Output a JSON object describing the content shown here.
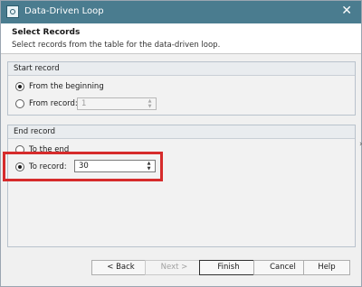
{
  "window": {
    "title": "Data-Driven Loop",
    "close_icon": "close-icon",
    "app_icon": "app-icon"
  },
  "header": {
    "title": "Select Records",
    "subtitle": "Select records from the table for the data-driven loop."
  },
  "start_record": {
    "group_title": "Start record",
    "option_beginning": {
      "label": "From the beginning",
      "selected": true
    },
    "option_from_record": {
      "label": "From record:",
      "selected": false,
      "value": "1",
      "enabled": false
    }
  },
  "end_record": {
    "group_title": "End record",
    "option_end": {
      "label": "To the end",
      "selected": false
    },
    "option_to_record": {
      "label": "To record:",
      "selected": true,
      "value": "30",
      "enabled": true
    }
  },
  "buttons": {
    "back": "< Back",
    "next": "Next >",
    "finish": "Finish",
    "cancel": "Cancel",
    "help": "Help"
  },
  "colors": {
    "titlebar": "#4a7c8f",
    "highlight": "#d62b2b"
  }
}
